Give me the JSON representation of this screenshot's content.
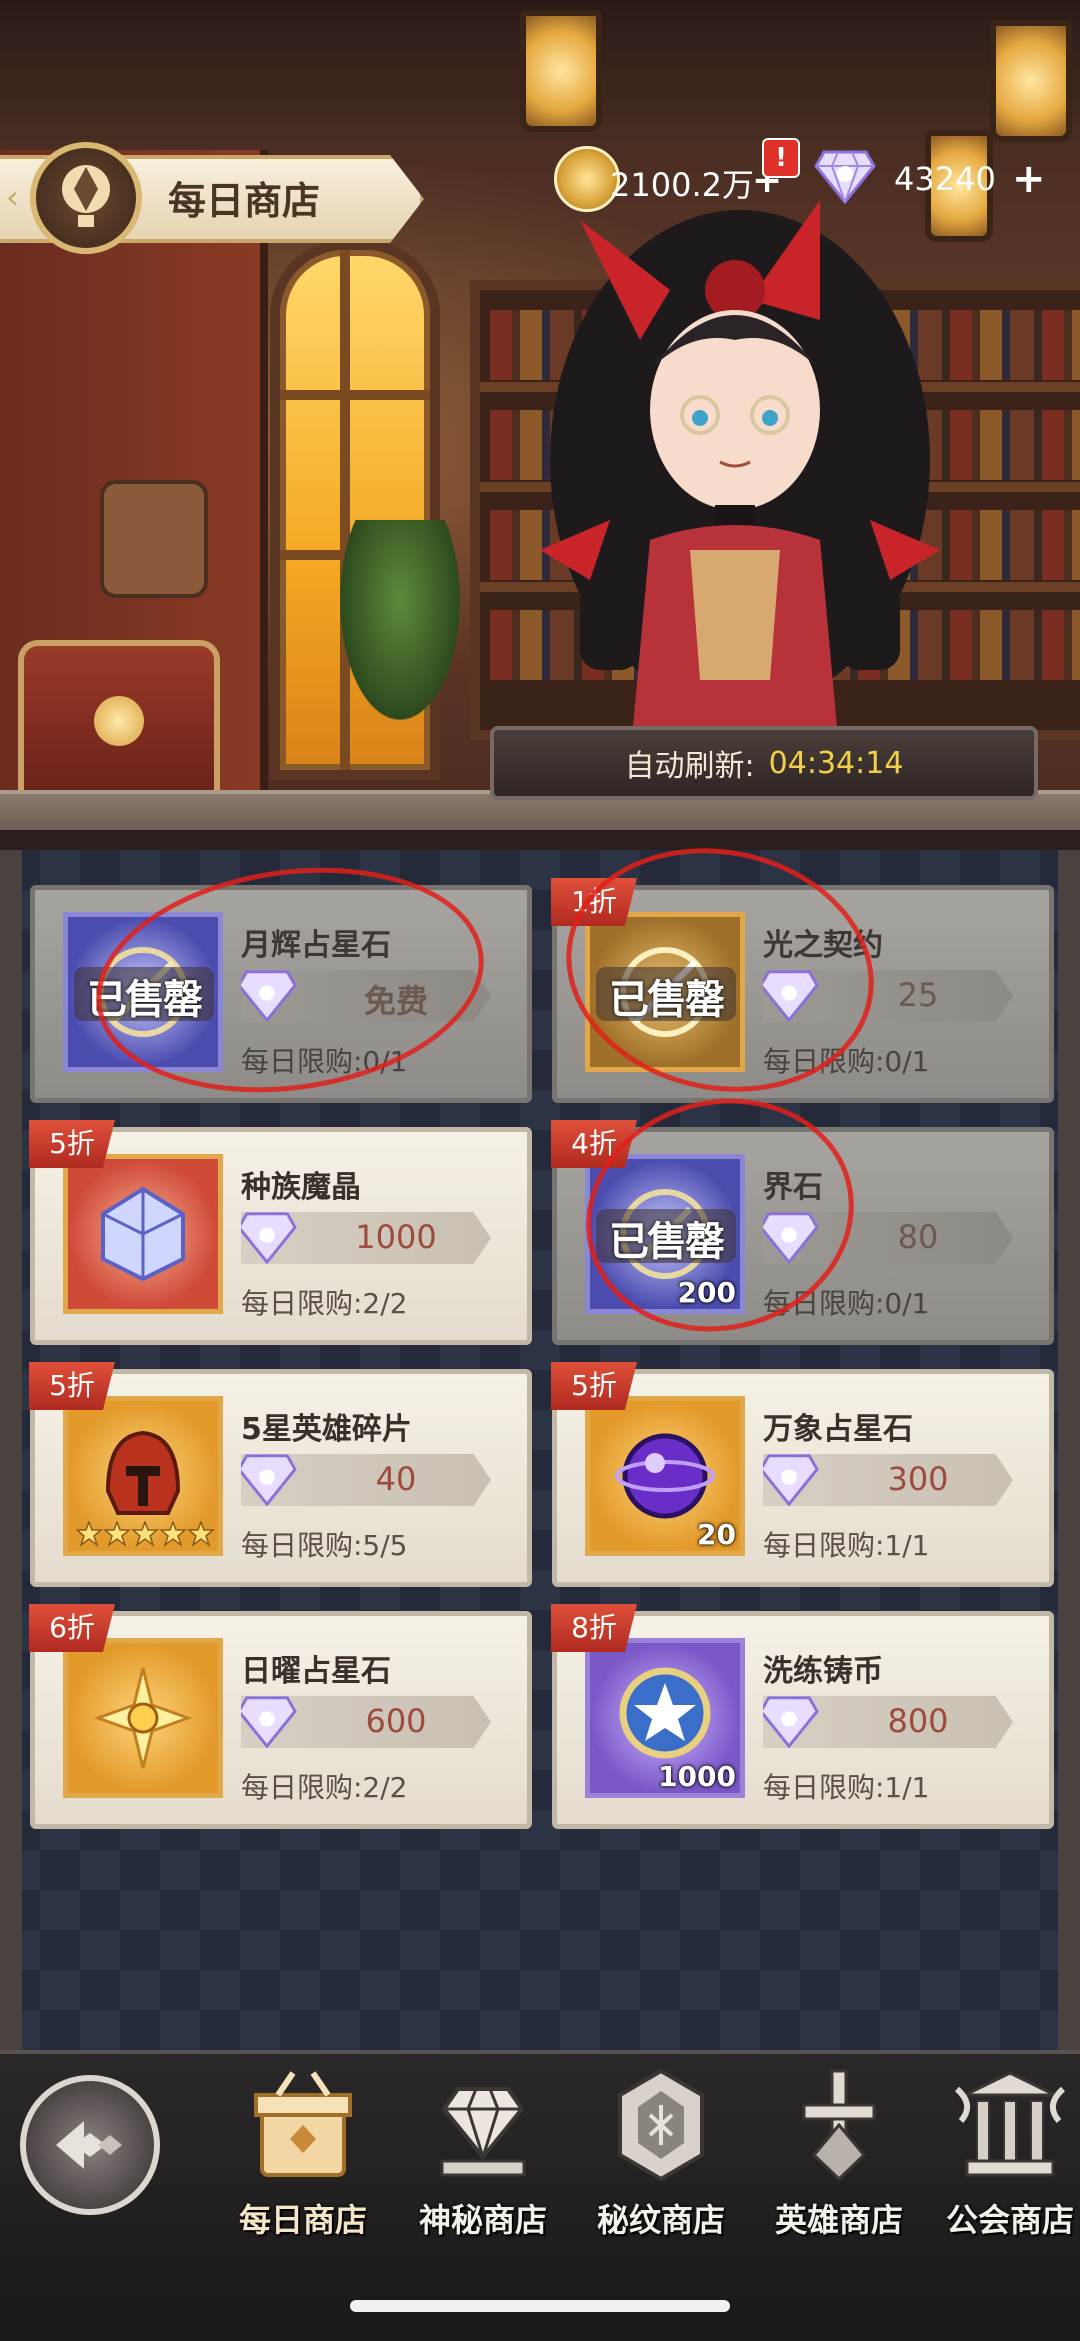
{
  "header": {
    "title": "每日商店",
    "gold_value": "2100.2万",
    "gold_plus": "+",
    "gold_alert": "!",
    "gem_value": "43240",
    "gem_plus": "+"
  },
  "refresh": {
    "label": "自动刷新:",
    "timer": "04:34:14"
  },
  "shop": {
    "items": [
      {
        "name": "月辉占星石",
        "discount": "",
        "price": "免费",
        "limit": "每日限购:0/1",
        "sold_out": true,
        "stamp": "已售罄",
        "qty": ""
      },
      {
        "name": "光之契约",
        "discount": "1折",
        "price": "25",
        "limit": "每日限购:0/1",
        "sold_out": true,
        "stamp": "已售罄",
        "qty": ""
      },
      {
        "name": "种族魔晶",
        "discount": "5折",
        "price": "1000",
        "limit": "每日限购:2/2",
        "sold_out": false,
        "stamp": "",
        "qty": ""
      },
      {
        "name": "界石",
        "discount": "4折",
        "price": "80",
        "limit": "每日限购:0/1",
        "sold_out": true,
        "stamp": "已售罄",
        "qty": "200"
      },
      {
        "name": "5星英雄碎片",
        "discount": "5折",
        "price": "40",
        "limit": "每日限购:5/5",
        "sold_out": false,
        "stamp": "",
        "qty": ""
      },
      {
        "name": "万象占星石",
        "discount": "5折",
        "price": "300",
        "limit": "每日限购:1/1",
        "sold_out": false,
        "stamp": "",
        "qty": "20"
      },
      {
        "name": "日曜占星石",
        "discount": "6折",
        "price": "600",
        "limit": "每日限购:2/2",
        "sold_out": false,
        "stamp": "",
        "qty": ""
      },
      {
        "name": "洗练铸币",
        "discount": "8折",
        "price": "800",
        "limit": "每日限购:1/1",
        "sold_out": false,
        "stamp": "",
        "qty": "1000"
      }
    ]
  },
  "nav": {
    "items": [
      {
        "label": "每日商店",
        "active": true
      },
      {
        "label": "神秘商店",
        "active": false
      },
      {
        "label": "秘纹商店",
        "active": false
      },
      {
        "label": "英雄商店",
        "active": false
      },
      {
        "label": "公会商店",
        "active": false
      }
    ]
  },
  "colors": {
    "accent_gold": "#d9b873",
    "discount_red": "#c23a2a",
    "timer_yellow": "#f2d04a",
    "price_red": "#9e4a3c"
  }
}
